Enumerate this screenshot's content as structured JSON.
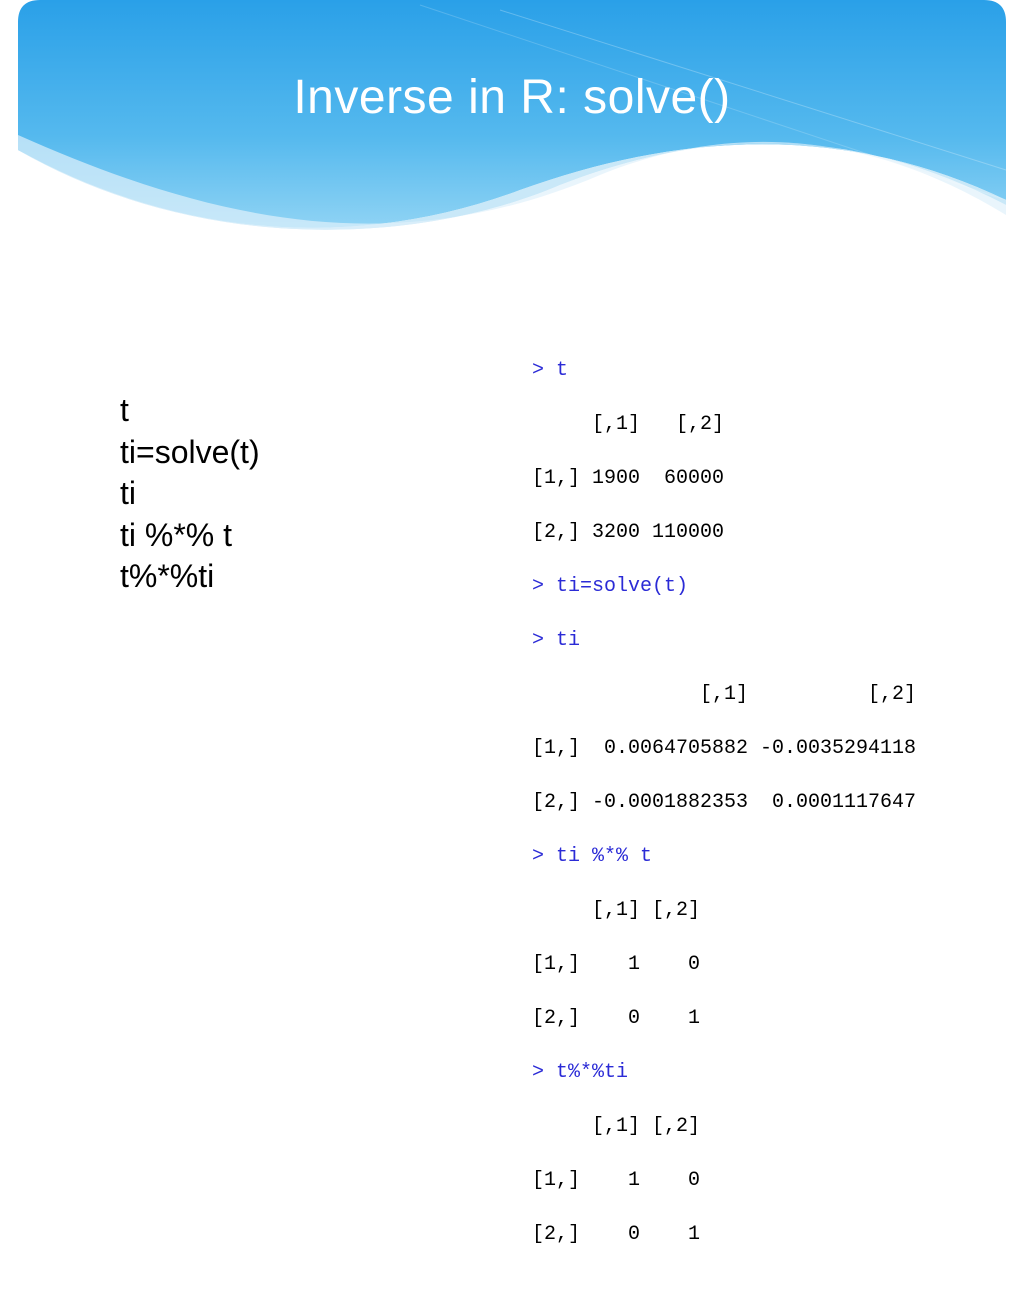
{
  "title": "Inverse in R: solve()",
  "left": {
    "l1": "t",
    "l2": "ti=solve(t)",
    "l3": "ti",
    "l4": "ti %*% t",
    "l5": "t%*%ti"
  },
  "console": {
    "p1": "> t",
    "o1a": "     [,1]   [,2]",
    "o1b": "[1,] 1900  60000",
    "o1c": "[2,] 3200 110000",
    "p2": "> ti=solve(t)",
    "p3": "> ti",
    "o3a": "              [,1]          [,2]",
    "o3b": "[1,]  0.0064705882 -0.0035294118",
    "o3c": "[2,] -0.0001882353  0.0001117647",
    "p4": "> ti %*% t",
    "o4a": "     [,1] [,2]",
    "o4b": "[1,]    1    0",
    "o4c": "[2,]    0    1",
    "p5": "> t%*%ti",
    "o5a": "     [,1] [,2]",
    "o5b": "[1,]    1    0",
    "o5c": "[2,]    0    1"
  }
}
